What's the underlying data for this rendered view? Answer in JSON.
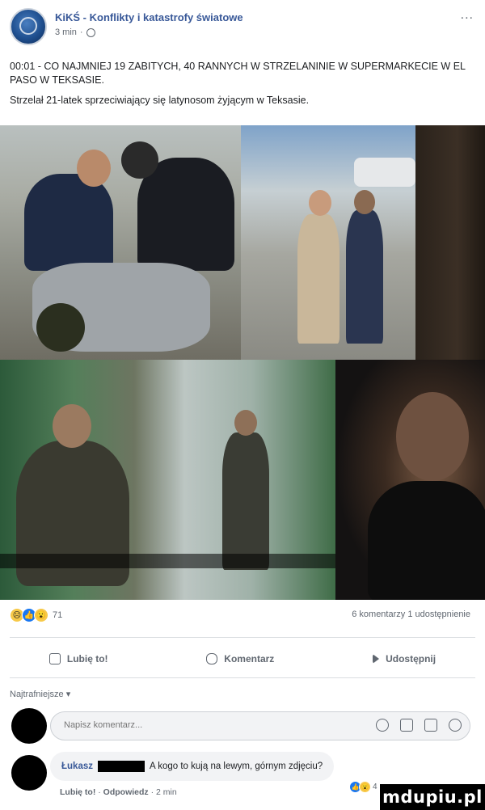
{
  "header": {
    "page_name": "KiKŚ - Konflikty i katastrofy światowe",
    "time": "3 min",
    "more": "..."
  },
  "post": {
    "line1": "00:01 - CO NAJMNIEJ 19 ZABITYCH, 40 RANNYCH W STRZELANINIE W SUPERMARKECIE W EL PASO W TEKSASIE.",
    "line2": "Strzelał 21-latek sprzeciwiający się latynosom żyjącym w Teksasie."
  },
  "reactions": {
    "icons": [
      "sad-emoji",
      "like-icon",
      "wow-emoji"
    ],
    "count": "71",
    "summary": "6 komentarzy   1 udostępnienie"
  },
  "actions": {
    "like": "Lubię to!",
    "comment": "Komentarz",
    "share": "Udostępnij"
  },
  "sort": "Najtrafniejsze ▾",
  "composer": {
    "placeholder": "Napisz komentarz..."
  },
  "comment": {
    "author": "Łukasz",
    "text": "A kogo to kują na lewym, górnym zdjęciu?",
    "like": "Lubię to!",
    "reply": "Odpowiedz",
    "time": "2 min",
    "reaction_count": "4"
  },
  "watermark": "mdupiu.pl",
  "colors": {
    "link": "#385898",
    "muted": "#606770",
    "divider": "#dadde1",
    "fb_blue": "#1877f2"
  }
}
